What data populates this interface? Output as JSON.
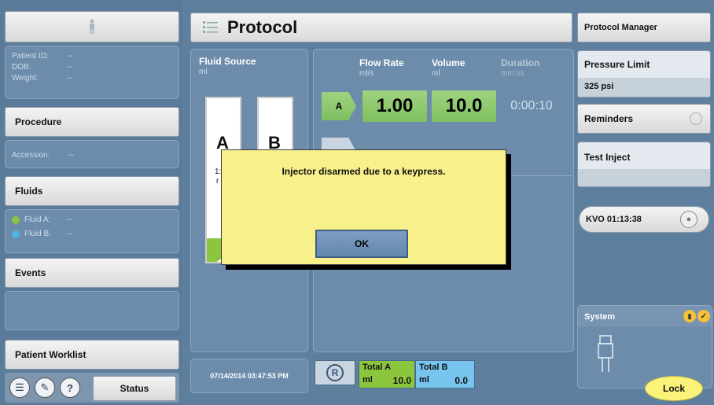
{
  "left": {
    "patient": {
      "id_label": "Patient ID:",
      "id_value": "--",
      "dob_label": "DOB:",
      "dob_value": "--",
      "weight_label": "Weight:",
      "weight_value": "--"
    },
    "procedure_label": "Procedure",
    "accession_label": "Accession:",
    "accession_value": "--",
    "fluids_label": "Fluids",
    "fluid_a_label": "Fluid A:",
    "fluid_a_value": "--",
    "fluid_b_label": "Fluid B:",
    "fluid_b_value": "--",
    "events_label": "Events",
    "worklist_label": "Patient Worklist",
    "status_label": "Status"
  },
  "protocol": {
    "title": "Protocol",
    "fluid_source_label": "Fluid Source",
    "fluid_source_unit": "ml",
    "syringe_a": "A",
    "syringe_b": "B",
    "syringe_a_partial": "1:",
    "syringe_a_partial2": "r",
    "headers": {
      "flow_rate": "Flow Rate",
      "flow_rate_unit": "ml/s",
      "volume": "Volume",
      "volume_unit": "ml",
      "duration": "Duration",
      "duration_unit": "mm:ss"
    },
    "phase": {
      "label": "A",
      "flow_rate": "1.00",
      "volume": "10.0",
      "duration": "0:00:10"
    },
    "timestamp": "07/14/2014 03:47:53 PM",
    "reset_label": "R",
    "total_a_label": "Total A",
    "total_a_unit": "ml",
    "total_a_value": "10.0",
    "total_b_label": "Total B",
    "total_b_unit": "ml",
    "total_b_value": "0.0"
  },
  "right": {
    "protocol_manager": "Protocol Manager",
    "pressure_limit_label": "Pressure Limit",
    "pressure_limit_value": "325 psi",
    "reminders_label": "Reminders",
    "test_inject_label": "Test Inject",
    "kvo_label": "KVO 01:13:38",
    "system_label": "System",
    "lock_label": "Lock"
  },
  "dialog": {
    "message": "Injector disarmed due to a keypress.",
    "ok_label": "OK"
  },
  "colors": {
    "fluid_a": "#8cc63f",
    "fluid_b": "#4fb3e8",
    "accent_green": "#8cc63f",
    "dialog_bg": "#f8f08a"
  },
  "icons": {
    "patient": "person-icon",
    "protocol": "list-icon",
    "reminders": "timer-icon",
    "kvo": "drop-icon",
    "system_a": "syringe-status-icon",
    "system_b": "check-icon"
  }
}
